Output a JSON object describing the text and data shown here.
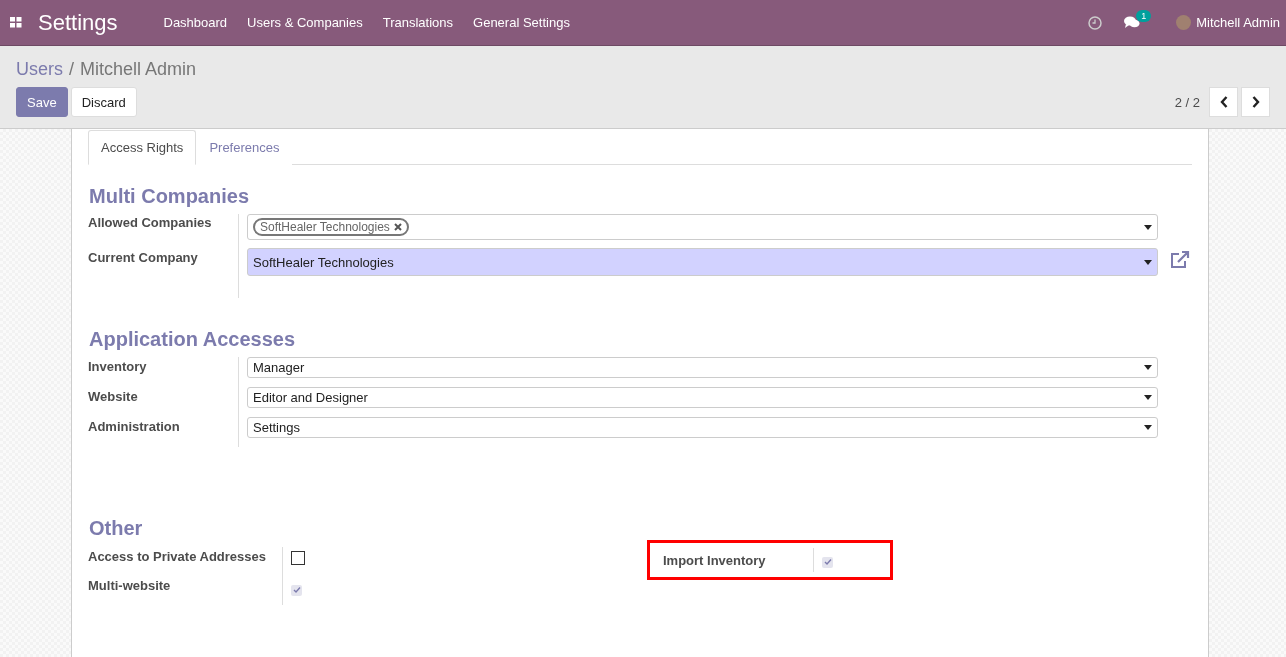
{
  "navbar": {
    "app_title": "Settings",
    "menu": [
      "Dashboard",
      "Users & Companies",
      "Translations",
      "General Settings"
    ],
    "messages_badge": "1",
    "user": "Mitchell Admin"
  },
  "breadcrumb": {
    "parent": "Users",
    "separator": "/",
    "current": "Mitchell Admin"
  },
  "buttons": [
    {
      "label": "Save",
      "kind": "primary"
    },
    {
      "label": "Discard",
      "kind": "secondary"
    }
  ],
  "pager": "2 / 2",
  "tabs": [
    {
      "label": "Access Rights",
      "selected": true
    },
    {
      "label": "Preferences",
      "selected": false
    }
  ],
  "multi_companies": {
    "title": "Multi Companies",
    "allowed_companies": {
      "label": "Allowed Companies",
      "tags": [
        "SoftHealer Technologies"
      ]
    },
    "current_company": {
      "label": "Current Company",
      "value": "SoftHealer Technologies"
    }
  },
  "application_accesses": {
    "title": "Application Accesses",
    "fields": [
      {
        "label": "Inventory",
        "value": "Manager"
      },
      {
        "label": "Website",
        "value": "Editor and Designer"
      },
      {
        "label": "Administration",
        "value": "Settings"
      }
    ]
  },
  "other": {
    "title": "Other",
    "left": [
      {
        "label": "Access to Private Addresses",
        "checked": false,
        "disabled": false,
        "highlighted": false
      },
      {
        "label": "Multi-website",
        "checked": true,
        "disabled": true,
        "highlighted": false
      }
    ],
    "right": [
      {
        "label": "Import Inventory",
        "checked": true,
        "disabled": true,
        "highlighted": true
      }
    ]
  }
}
